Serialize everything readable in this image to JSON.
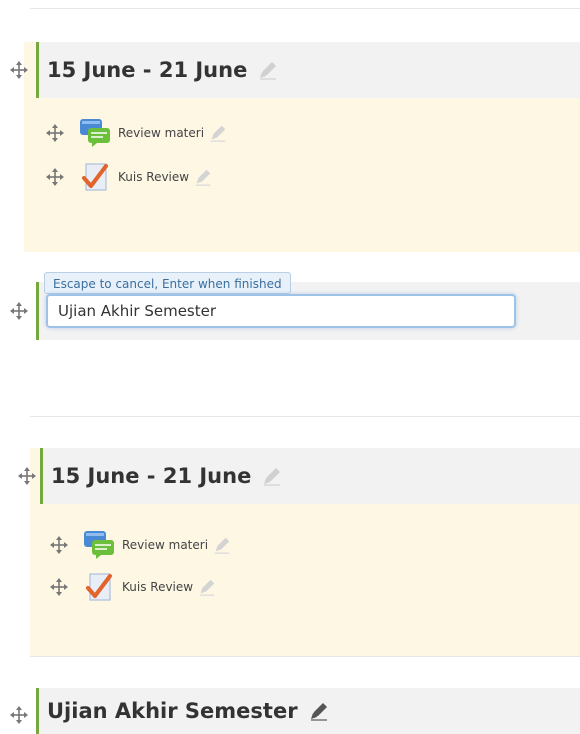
{
  "sections": [
    {
      "title": "15 June - 21 June",
      "activities": [
        {
          "label": "Review materi",
          "icon": "forum-icon"
        },
        {
          "label": "Kuis Review",
          "icon": "quiz-icon"
        }
      ]
    },
    {
      "title": "15 June - 21 June",
      "activities": [
        {
          "label": "Review materi",
          "icon": "forum-icon"
        },
        {
          "label": "Kuis Review",
          "icon": "quiz-icon"
        }
      ]
    },
    {
      "title": "Ujian Akhir Semester",
      "activities": []
    }
  ],
  "editing": {
    "tooltip": "Escape to cancel, Enter when finished",
    "value": "Ujian Akhir Semester"
  },
  "colors": {
    "accent": "#76a83f",
    "header_bg": "#f2f2f2",
    "panel_bg": "#fdf7e4",
    "input_border": "#9fc3e7"
  }
}
